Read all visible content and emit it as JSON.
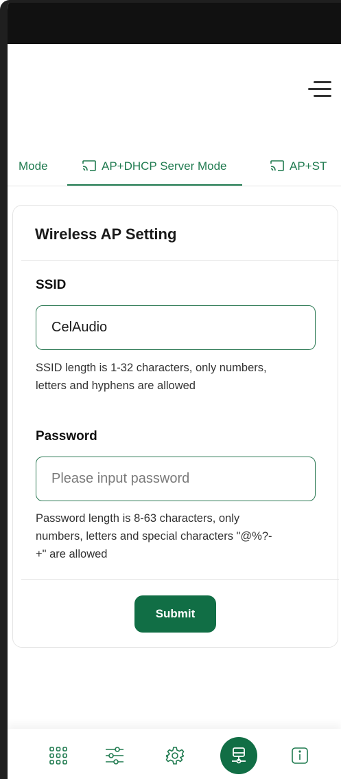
{
  "tabs": [
    {
      "label": "Mode",
      "active": false,
      "icon": "none"
    },
    {
      "label": "AP+DHCP Server Mode",
      "active": true,
      "icon": "cast-icon"
    },
    {
      "label": "AP+ST",
      "active": false,
      "icon": "cast-icon"
    }
  ],
  "card": {
    "title": "Wireless AP Setting",
    "ssid": {
      "label": "SSID",
      "value": "CelAudio",
      "hint_line1": "SSID length is 1-32 characters, only numbers,",
      "hint_line2": "letters and hyphens are allowed"
    },
    "password": {
      "label": "Password",
      "placeholder": "Please input password",
      "hint_line1": "Password length is 8-63 characters, only",
      "hint_line2": "numbers, letters and special characters \"@%?-",
      "hint_line3": "+\" are allowed"
    },
    "submit_label": "Submit"
  },
  "bottom_nav": [
    {
      "name": "grid-icon",
      "active": false
    },
    {
      "name": "sliders-icon",
      "active": false
    },
    {
      "name": "gear-icon",
      "active": false
    },
    {
      "name": "network-icon",
      "active": true
    },
    {
      "name": "info-icon",
      "active": false
    }
  ],
  "colors": {
    "accent": "#116e45",
    "tab_text": "#1f7a4f",
    "status_bar": "#111111"
  }
}
